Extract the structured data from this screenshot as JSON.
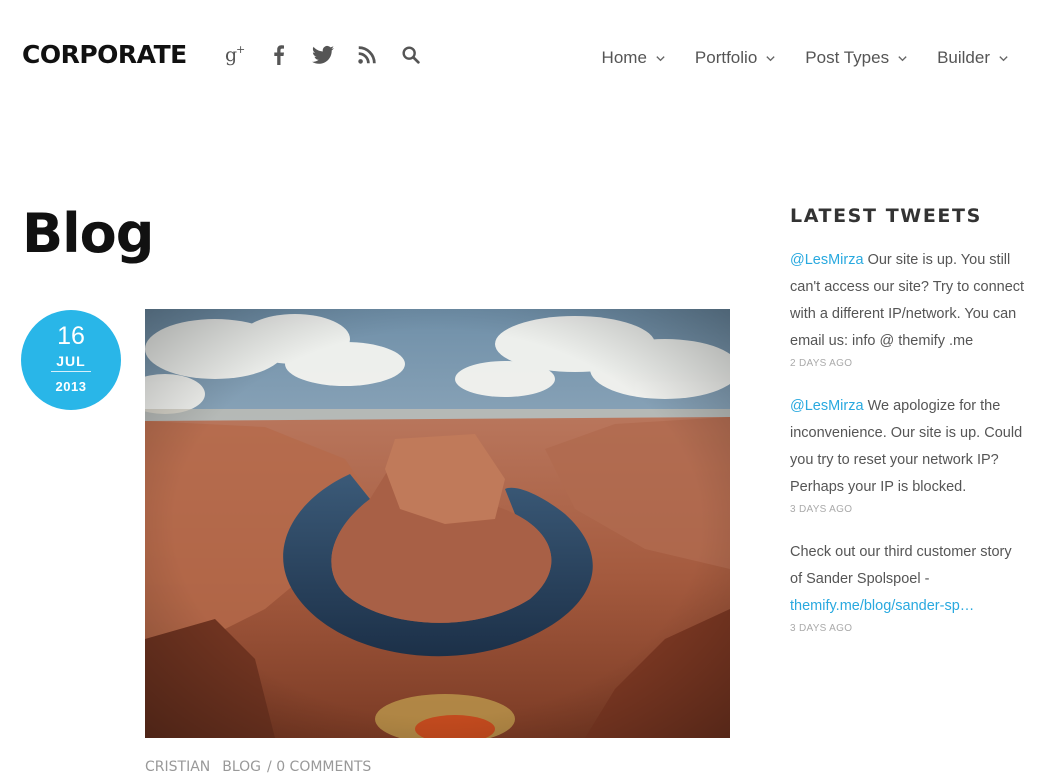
{
  "header": {
    "logo": "CORPORATE",
    "social": [
      "google-plus-icon",
      "facebook-icon",
      "twitter-icon",
      "rss-icon",
      "search-icon"
    ],
    "nav": [
      {
        "label": "Home"
      },
      {
        "label": "Portfolio"
      },
      {
        "label": "Post Types"
      },
      {
        "label": "Builder"
      }
    ]
  },
  "page": {
    "title": "Blog"
  },
  "post": {
    "date": {
      "day": "16",
      "month": "JUL",
      "year": "2013"
    },
    "meta": {
      "author": "CRISTIAN",
      "category": "BLOG",
      "comments": "/ 0 COMMENTS"
    }
  },
  "sidebar": {
    "heading": "LATEST TWEETS",
    "tweets": [
      {
        "mention": "@LesMirza",
        "text": " Our site is up. You still can't access our site? Try to connect with a different IP/network. You can email us: info @ themify .me",
        "time": "2 DAYS AGO"
      },
      {
        "mention": "@LesMirza",
        "text": " We apologize for the inconvenience. Our site is up. Could you try to reset your network IP? Perhaps your IP is blocked.",
        "time": "3 DAYS AGO"
      },
      {
        "text": "Check out our third customer story of Sander Spolspoel - ",
        "link": "themify.me/blog/sander-sp…",
        "time": "3 DAYS AGO"
      }
    ]
  },
  "colors": {
    "accent": "#29b6e8",
    "link": "#29a9df"
  }
}
